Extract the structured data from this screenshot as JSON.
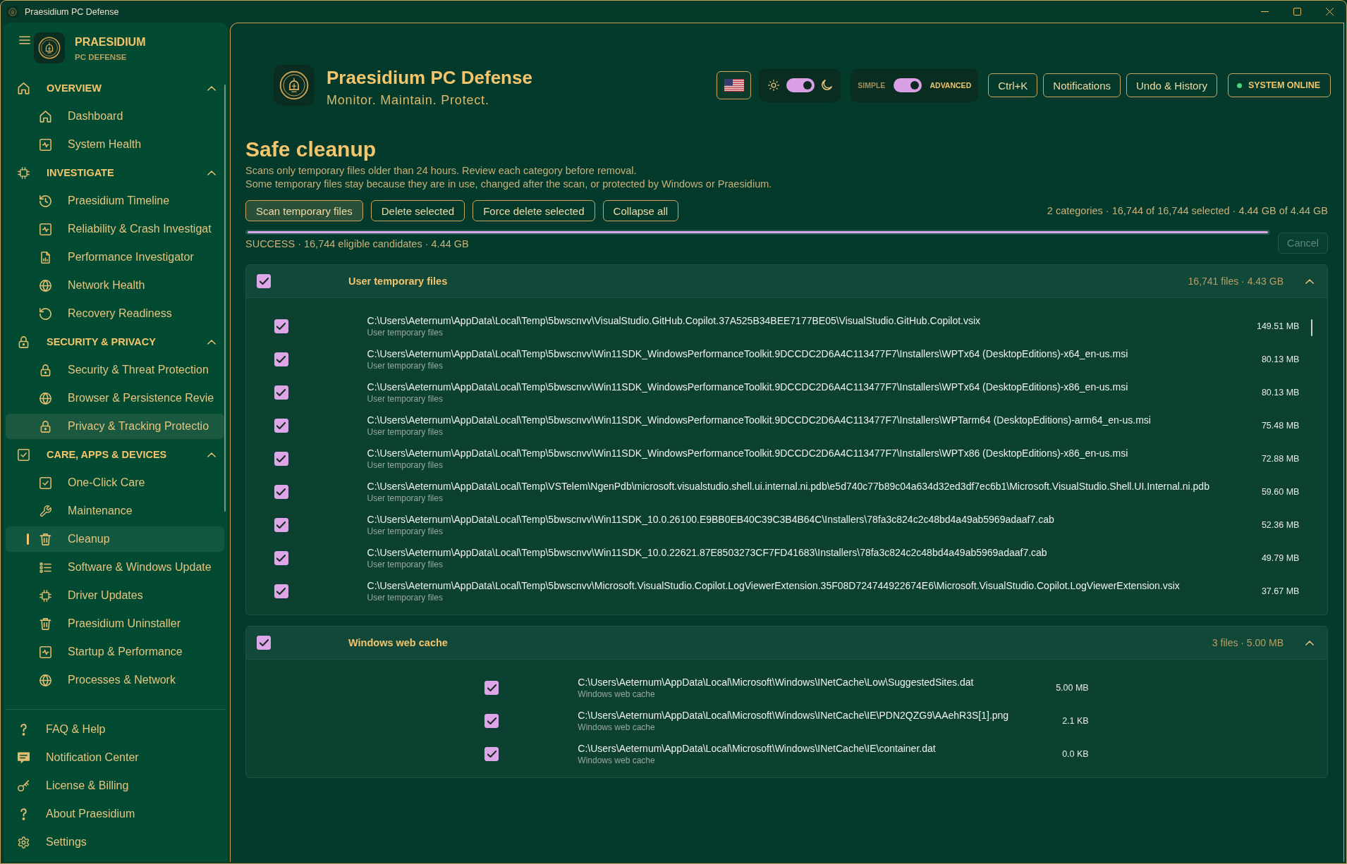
{
  "window": {
    "title": "Praesidium PC Defense"
  },
  "sidebar": {
    "brand": {
      "name": "PRAESIDIUM",
      "tagline": "PC DEFENSE"
    },
    "sections": [
      {
        "title": "OVERVIEW",
        "expanded": true,
        "items": [
          {
            "label": "Dashboard",
            "selected": false,
            "hovered": false
          },
          {
            "label": "System Health",
            "selected": false,
            "hovered": false
          }
        ]
      },
      {
        "title": "INVESTIGATE",
        "expanded": true,
        "items": [
          {
            "label": "Praesidium Timeline",
            "selected": false,
            "hovered": false
          },
          {
            "label": "Reliability & Crash Investigat",
            "selected": false,
            "hovered": false
          },
          {
            "label": "Performance Investigator",
            "selected": false,
            "hovered": false
          },
          {
            "label": "Network Health",
            "selected": false,
            "hovered": false
          },
          {
            "label": "Recovery Readiness",
            "selected": false,
            "hovered": false
          }
        ]
      },
      {
        "title": "SECURITY & PRIVACY",
        "expanded": true,
        "items": [
          {
            "label": "Security & Threat Protection",
            "selected": false,
            "hovered": false
          },
          {
            "label": "Browser & Persistence Revie",
            "selected": false,
            "hovered": false
          },
          {
            "label": "Privacy & Tracking Protectio",
            "selected": false,
            "hovered": true
          }
        ]
      },
      {
        "title": "CARE, APPS & DEVICES",
        "expanded": true,
        "items": [
          {
            "label": "One-Click Care",
            "selected": false,
            "hovered": false
          },
          {
            "label": "Maintenance",
            "selected": false,
            "hovered": false
          },
          {
            "label": "Cleanup",
            "selected": true,
            "hovered": false
          },
          {
            "label": "Software & Windows Update",
            "selected": false,
            "hovered": false
          },
          {
            "label": "Driver Updates",
            "selected": false,
            "hovered": false
          },
          {
            "label": "Praesidium Uninstaller",
            "selected": false,
            "hovered": false
          },
          {
            "label": "Startup & Performance",
            "selected": false,
            "hovered": false
          },
          {
            "label": "Processes & Network",
            "selected": false,
            "hovered": false
          }
        ]
      }
    ],
    "footer": [
      {
        "label": "FAQ & Help",
        "selected": false
      },
      {
        "label": "Notification Center",
        "selected": false
      },
      {
        "label": "License & Billing",
        "selected": false
      },
      {
        "label": "About Praesidium",
        "selected": false
      },
      {
        "label": "Settings",
        "selected": false
      }
    ]
  },
  "header": {
    "title": "Praesidium PC Defense",
    "subtitle": "Monitor. Maintain. Protect.",
    "theme_switch": {
      "on": true
    },
    "mode_switch": {
      "off_label": "SIMPLE",
      "on_label": "ADVANCED",
      "on": true
    },
    "buttons": [
      "Ctrl+K",
      "Notifications",
      "Undo & History"
    ],
    "status": {
      "label": "SYSTEM ONLINE",
      "color": "#4fcf86"
    }
  },
  "page": {
    "title": "Safe cleanup",
    "description": [
      "Scans only temporary files older than 24 hours. Review each category before removal.",
      "Some temporary files stay because they are in use, changed after the scan, or protected by Windows or Praesidium."
    ],
    "actions": [
      {
        "label": "Scan temporary files",
        "kind": "primary"
      },
      {
        "label": "Delete selected",
        "kind": "outline"
      },
      {
        "label": "Force delete selected",
        "kind": "outline"
      },
      {
        "label": "Collapse all",
        "kind": "outline"
      }
    ],
    "summary": "2 categories · 16,744 of 16,744 selected · 4.44 GB of 4.44 GB",
    "progress": {
      "level": 1,
      "status": "SUCCESS · 16,744 eligible candidates · 4.44 GB",
      "cancel": {
        "label": "Cancel",
        "disabled": true
      }
    }
  },
  "categories": [
    {
      "title": "User temporary files",
      "checked": true,
      "expanded": true,
      "scrollable": true,
      "summary": "16,741 files · 4.43 GB",
      "files": [
        {
          "path": "C:\\Users\\Aeternum\\AppData\\Local\\Temp\\5bwscnvv\\VisualStudio.GitHub.Copilot.37A525B34BEE7177BE05\\VisualStudio.GitHub.Copilot.vsix",
          "category": "User temporary files",
          "size": "149.51 MB",
          "checked": true
        },
        {
          "path": "C:\\Users\\Aeternum\\AppData\\Local\\Temp\\5bwscnvv\\Win11SDK_WindowsPerformanceToolkit.9DCCDC2D6A4C113477F7\\Installers\\WPTx64 (DesktopEditions)-x64_en-us.msi",
          "category": "User temporary files",
          "size": "80.13 MB",
          "checked": true
        },
        {
          "path": "C:\\Users\\Aeternum\\AppData\\Local\\Temp\\5bwscnvv\\Win11SDK_WindowsPerformanceToolkit.9DCCDC2D6A4C113477F7\\Installers\\WPTx64 (DesktopEditions)-x86_en-us.msi",
          "category": "User temporary files",
          "size": "80.13 MB",
          "checked": true
        },
        {
          "path": "C:\\Users\\Aeternum\\AppData\\Local\\Temp\\5bwscnvv\\Win11SDK_WindowsPerformanceToolkit.9DCCDC2D6A4C113477F7\\Installers\\WPTarm64 (DesktopEditions)-arm64_en-us.msi",
          "category": "User temporary files",
          "size": "75.48 MB",
          "checked": true
        },
        {
          "path": "C:\\Users\\Aeternum\\AppData\\Local\\Temp\\5bwscnvv\\Win11SDK_WindowsPerformanceToolkit.9DCCDC2D6A4C113477F7\\Installers\\WPTx86 (DesktopEditions)-x86_en-us.msi",
          "category": "User temporary files",
          "size": "72.88 MB",
          "checked": true
        },
        {
          "path": "C:\\Users\\Aeternum\\AppData\\Local\\Temp\\VSTelem\\NgenPdb\\microsoft.visualstudio.shell.ui.internal.ni.pdb\\e5d740c77b89c04a634d32ed3df7ec6b1\\Microsoft.VisualStudio.Shell.UI.Internal.ni.pdb",
          "category": "User temporary files",
          "size": "59.60 MB",
          "checked": true
        },
        {
          "path": "C:\\Users\\Aeternum\\AppData\\Local\\Temp\\5bwscnvv\\Win11SDK_10.0.26100.E9BB0EB40C39C3B4B64C\\Installers\\78fa3c824c2c48bd4a49ab5969adaaf7.cab",
          "category": "User temporary files",
          "size": "52.36 MB",
          "checked": true
        },
        {
          "path": "C:\\Users\\Aeternum\\AppData\\Local\\Temp\\5bwscnvv\\Win11SDK_10.0.22621.87E8503273CF7FD41683\\Installers\\78fa3c824c2c48bd4a49ab5969adaaf7.cab",
          "category": "User temporary files",
          "size": "49.79 MB",
          "checked": true
        },
        {
          "path": "C:\\Users\\Aeternum\\AppData\\Local\\Temp\\5bwscnvv\\Microsoft.VisualStudio.Copilot.LogViewerExtension.35F08D724744922674E6\\Microsoft.VisualStudio.Copilot.LogViewerExtension.vsix",
          "category": "User temporary files",
          "size": "37.67 MB",
          "checked": true
        }
      ]
    },
    {
      "title": "Windows web cache",
      "checked": true,
      "expanded": true,
      "scrollable": false,
      "summary": "3 files · 5.00 MB",
      "files": [
        {
          "path": "C:\\Users\\Aeternum\\AppData\\Local\\Microsoft\\Windows\\INetCache\\Low\\SuggestedSites.dat",
          "category": "Windows web cache",
          "size": "5.00 MB",
          "checked": true
        },
        {
          "path": "C:\\Users\\Aeternum\\AppData\\Local\\Microsoft\\Windows\\INetCache\\IE\\PDN2QZG9\\AAehR3S[1].png",
          "category": "Windows web cache",
          "size": "2.1 KB",
          "checked": true
        },
        {
          "path": "C:\\Users\\Aeternum\\AppData\\Local\\Microsoft\\Windows\\INetCache\\IE\\container.dat",
          "category": "Windows web cache",
          "size": "0.0 KB",
          "checked": true
        }
      ]
    }
  ]
}
